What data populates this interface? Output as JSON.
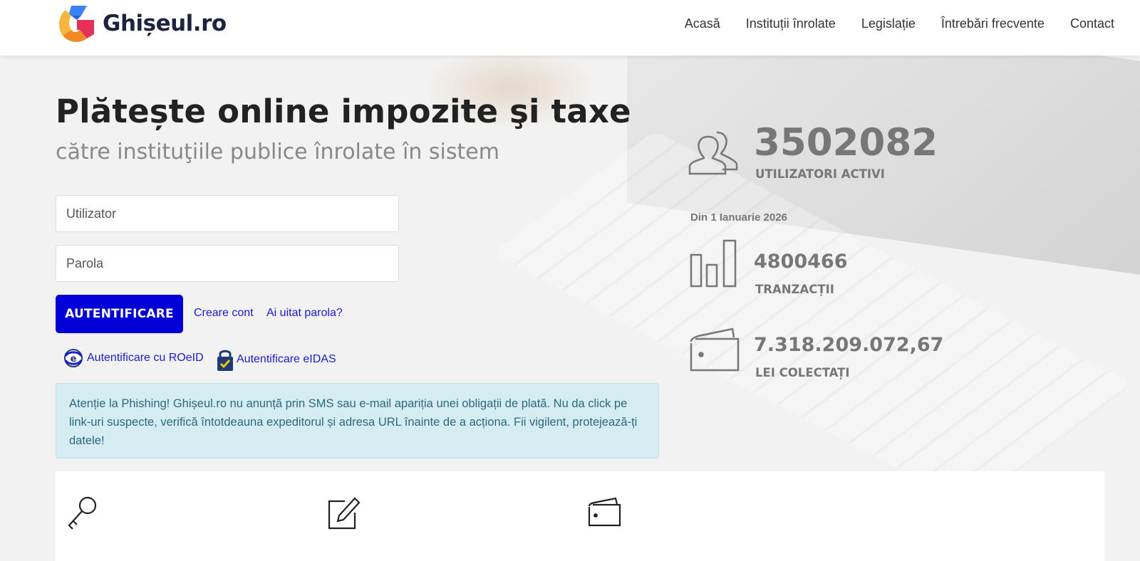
{
  "brand": {
    "name": "Ghișeul.ro"
  },
  "nav": {
    "items": [
      {
        "label": "Acasă"
      },
      {
        "label": "Instituții înrolate"
      },
      {
        "label": "Legislație"
      },
      {
        "label": "Întrebări frecvente"
      },
      {
        "label": "Contact"
      }
    ]
  },
  "hero": {
    "title": "Plătește online impozite şi taxe",
    "subtitle": "către instituţiile publice înrolate în sistem"
  },
  "login": {
    "username_placeholder": "Utilizator",
    "password_placeholder": "Parola",
    "submit_label": "AUTENTIFICARE",
    "create_account": "Creare cont",
    "forgot_password": "Ai uitat parola?",
    "roeid_label": "Autentificare cu ROeID",
    "eidas_label": "Autentificare eIDAS"
  },
  "alert": {
    "text": "Atenție la Phishing! Ghișeul.ro nu anunță prin SMS sau e-mail apariția unei obligații de plată. Nu da click pe link-uri suspecte, verifică întotdeauna expeditorul și adresa URL înainte de a acționa. Fii vigilent, protejează-ți datele!"
  },
  "stats": {
    "users": {
      "value": "3502082",
      "label": "UTILIZATORI ACTIVI"
    },
    "since": "Din 1 Ianuarie 2026",
    "transactions": {
      "value": "4800466",
      "label": "TRANZACȚII"
    },
    "collected": {
      "value": "7.318.209.072,67",
      "label": "LEI COLECTAȚI"
    }
  },
  "icons": {
    "users": "users-icon",
    "transactions": "bar-chart-icon",
    "collected": "wallet-icon",
    "feature_1": "key-icon",
    "feature_2": "edit-icon",
    "feature_3": "wallet-icon"
  },
  "colors": {
    "primary_button": "#0000d7",
    "link": "#1a1ad1",
    "alert_bg": "#d6ecf3",
    "alert_text": "#2a6a7e",
    "stat_gray": "#777777"
  }
}
